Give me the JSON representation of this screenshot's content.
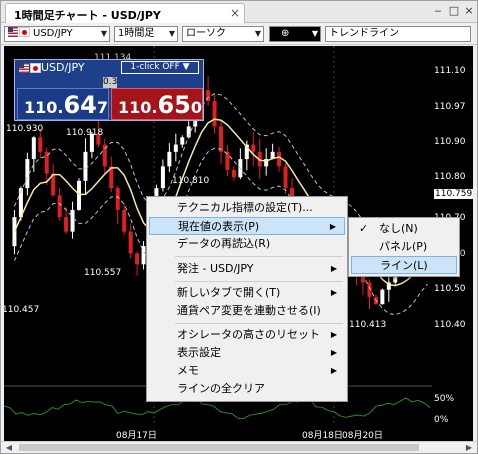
{
  "window": {
    "tab_title": "1時間足チャート - USD/JPY",
    "close_glyph": "×",
    "minimize_glyph": "‒",
    "maximize_glyph": "□",
    "close_window_glyph": "×"
  },
  "toolbar": {
    "pair": "USD/JPY",
    "timeframe": "1時間足",
    "chart_type": "ローソク",
    "draw_tool": "⊕",
    "line_tool": "トレンドライン",
    "dropdown_glyph": "▼"
  },
  "rate_panel": {
    "pair": "USD/JPY",
    "one_click": "1-click OFF ▼",
    "spread": "0.3",
    "bid": {
      "prefix": "110.",
      "main": "64",
      "suffix": "7"
    },
    "ask": {
      "prefix": "110.",
      "main": "65",
      "suffix": "0"
    }
  },
  "chart": {
    "header_partial": "111.134",
    "price_ticks": [
      "111.10",
      "110.97",
      "110.90",
      "110.80",
      "110.759",
      "110.70",
      "110.60",
      "110.50",
      "110.40"
    ],
    "highlighted_tick": "110.759",
    "osc_ticks": [
      "50%",
      "0%"
    ],
    "annotations": [
      "110.930",
      "110.918",
      "110.810",
      "110.557",
      "110.457",
      "110.413"
    ],
    "x_labels": [
      "08月17日",
      "08月18日",
      "08月20日"
    ],
    "colors": {
      "up": "#ffffff",
      "down": "#e02020",
      "ma": "#f4e8a0",
      "band": "#c0c0c0",
      "osc": "#2a8a2a"
    }
  },
  "context_menu": {
    "items": [
      {
        "label": "テクニカル指標の設定(T)...",
        "submenu": false
      },
      {
        "label": "現在値の表示(P)",
        "submenu": true,
        "selected": true
      },
      {
        "label": "データの再読込(R)",
        "submenu": false
      },
      {
        "label": "発注 - USD/JPY",
        "submenu": true
      },
      {
        "label": "新しいタブで開く(T)",
        "submenu": true
      },
      {
        "label": "通貨ペア変更を連動させる(I)",
        "submenu": false
      },
      {
        "label": "オシレータの高さのリセット",
        "submenu": true
      },
      {
        "label": "表示設定",
        "submenu": true
      },
      {
        "label": "メモ",
        "submenu": true
      },
      {
        "label": "ラインの全クリア",
        "submenu": false
      }
    ],
    "submenu_glyph": "▶"
  },
  "sub_menu": {
    "items": [
      {
        "label": "なし(N)",
        "checked": true
      },
      {
        "label": "パネル(P)",
        "checked": false
      },
      {
        "label": "ライン(L)",
        "checked": false,
        "selected": true
      }
    ],
    "check_glyph": "✓"
  },
  "scrollbar": {
    "left_glyph": "◀",
    "right_glyph": "▶"
  }
}
